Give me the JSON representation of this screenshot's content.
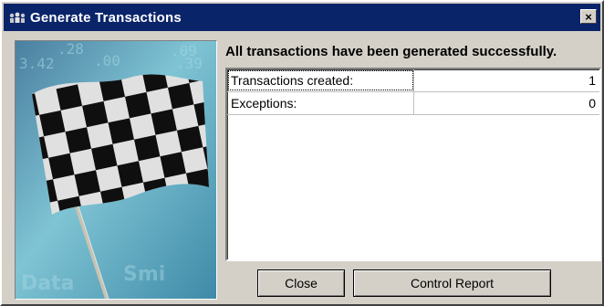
{
  "window": {
    "title": "Generate Transactions",
    "icon": "people-icon",
    "close_glyph": "×"
  },
  "side_image": {
    "subject": "checkered-flag",
    "background_text": [
      ".28",
      ".00",
      ".09",
      "3.42",
      ".39",
      "Data",
      "Smi"
    ]
  },
  "main": {
    "headline": "All transactions have been generated successfully.",
    "rows": [
      {
        "label": "Transactions created:",
        "value": "1"
      },
      {
        "label": "Exceptions:",
        "value": "0"
      }
    ]
  },
  "buttons": {
    "close_label": "Close",
    "report_label": "Control Report"
  },
  "colors": {
    "titlebar": "#0a246a",
    "face": "#d4d0c8"
  }
}
